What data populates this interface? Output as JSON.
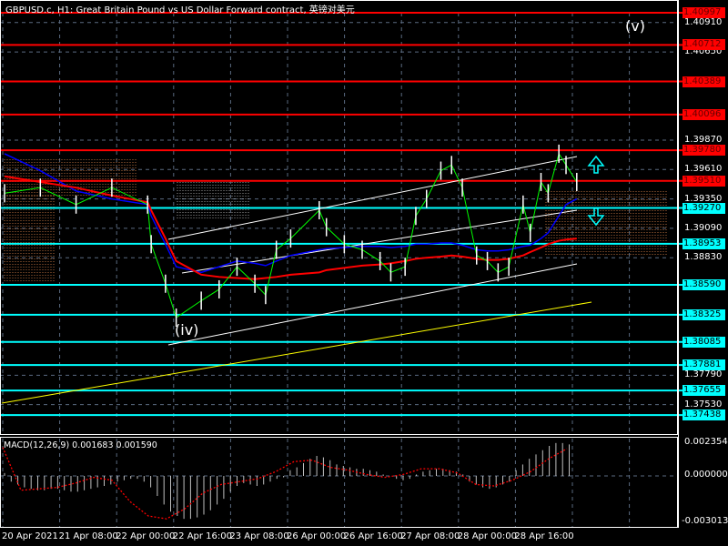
{
  "header": {
    "title": "GBPUSD.c, H1:  Great Britain Pound vs US Dollar Forward contract, 英镑对美元"
  },
  "annotations": {
    "wave_v": "(v)",
    "wave_iv": "(iv)"
  },
  "colors": {
    "background": "#000000",
    "resistance": "#ff0000",
    "support": "#00ffff",
    "price": "#00ff00",
    "ma_red": "#ff0000",
    "ma_blue": "#0000ff",
    "channel": "#ffffff",
    "trend": "#ffff00",
    "macd_signal": "#ff0000",
    "macd_hist": "#c0c0c0"
  },
  "price_levels": [
    {
      "label": "1.40997",
      "price": 1.40997,
      "type": "resistance"
    },
    {
      "label": "1.40712",
      "price": 1.40712,
      "type": "resistance"
    },
    {
      "label": "1.40389",
      "price": 1.40389,
      "type": "resistance"
    },
    {
      "label": "1.40096",
      "price": 1.40096,
      "type": "resistance"
    },
    {
      "label": "1.39780",
      "price": 1.3978,
      "type": "resistance"
    },
    {
      "label": "1.39510",
      "price": 1.3951,
      "type": "resistance"
    },
    {
      "label": "1.39270",
      "price": 1.3927,
      "type": "support"
    },
    {
      "label": "1.38953",
      "price": 1.38953,
      "type": "support"
    },
    {
      "label": "1.38590",
      "price": 1.3859,
      "type": "support"
    },
    {
      "label": "1.38325",
      "price": 1.38325,
      "type": "support"
    },
    {
      "label": "1.38085",
      "price": 1.38085,
      "type": "support"
    },
    {
      "label": "1.37881",
      "price": 1.37881,
      "type": "support"
    },
    {
      "label": "1.37655",
      "price": 1.37655,
      "type": "support"
    },
    {
      "label": "1.37438",
      "price": 1.37438,
      "type": "support"
    }
  ],
  "price_ticks": [
    "1.40910",
    "1.40650",
    "1.39870",
    "1.39610",
    "1.39350",
    "1.39090",
    "1.38830",
    "1.37790",
    "1.37530"
  ],
  "time_labels": [
    "20 Apr 2021",
    "21 Apr 08:00",
    "22 Apr 00:00",
    "22 Apr 16:00",
    "23 Apr 08:00",
    "26 Apr 00:00",
    "26 Apr 16:00",
    "27 Apr 08:00",
    "28 Apr 00:00",
    "28 Apr 16:00"
  ],
  "macd": {
    "label": "MACD(12,26,9) 0.001683 0.001590",
    "max_label": "0.002354",
    "zero_label": "0.000000",
    "min_label": "-0.003013"
  },
  "chart_data": {
    "type": "line",
    "title": "GBPUSD.c, H1",
    "ylim": [
      1.373,
      1.411
    ],
    "x_bars": [
      0,
      10,
      20,
      30,
      40,
      41,
      45,
      48,
      55,
      60,
      65,
      70,
      73,
      76,
      80,
      88,
      90,
      95,
      100,
      105,
      108,
      112,
      115,
      118,
      122,
      125,
      128,
      132,
      135,
      138,
      141,
      145,
      147,
      150,
      152,
      155,
      157,
      160
    ],
    "close": [
      1.394,
      1.3945,
      1.393,
      1.3945,
      1.393,
      1.3895,
      1.386,
      1.383,
      1.3845,
      1.3855,
      1.3875,
      1.386,
      1.385,
      1.389,
      1.39,
      1.3925,
      1.391,
      1.3895,
      1.389,
      1.388,
      1.387,
      1.3875,
      1.392,
      1.3935,
      1.396,
      1.3965,
      1.3945,
      1.3885,
      1.388,
      1.387,
      1.3875,
      1.393,
      1.3905,
      1.395,
      1.394,
      1.3975,
      1.3965,
      1.395
    ],
    "ma_red": [
      1.3955,
      1.395,
      1.3945,
      1.3938,
      1.3932,
      1.3925,
      1.39,
      1.388,
      1.3868,
      1.3866,
      1.3865,
      1.3864,
      1.3865,
      1.3866,
      1.3868,
      1.387,
      1.3872,
      1.3874,
      1.3876,
      1.3877,
      1.3878,
      1.388,
      1.3882,
      1.3883,
      1.3884,
      1.3885,
      1.3884,
      1.3882,
      1.3881,
      1.3881,
      1.3882,
      1.3885,
      1.3888,
      1.3892,
      1.3895,
      1.3898,
      1.3899,
      1.39
    ],
    "ma_blue": [
      1.3975,
      1.396,
      1.3942,
      1.3935,
      1.393,
      1.392,
      1.3895,
      1.3875,
      1.387,
      1.3875,
      1.388,
      1.3878,
      1.3876,
      1.388,
      1.3885,
      1.389,
      1.3891,
      1.3892,
      1.3893,
      1.3893,
      1.3892,
      1.3893,
      1.3895,
      1.3895,
      1.3896,
      1.3896,
      1.3894,
      1.389,
      1.3889,
      1.3889,
      1.389,
      1.3893,
      1.3894,
      1.39,
      1.3905,
      1.392,
      1.393,
      1.3935
    ],
    "macd_hist": [
      0.0002,
      -0.0004,
      -0.0006,
      -0.0008,
      -0.0009,
      -0.001,
      -0.001,
      -0.0009,
      -0.0009,
      -0.001,
      -0.0011,
      -0.0011,
      -0.001,
      -0.0009,
      -0.0008,
      -0.0007,
      -0.0006,
      -0.0004,
      -0.0003,
      -0.0002,
      -0.0002,
      -0.0004,
      -0.0008,
      -0.0014,
      -0.002,
      -0.0025,
      -0.0028,
      -0.003,
      -0.003,
      -0.0029,
      -0.0027,
      -0.0024,
      -0.002,
      -0.0016,
      -0.0011,
      -0.0007,
      -0.0005,
      -0.0006,
      -0.0007,
      -0.0006,
      -0.0004,
      -0.0002,
      -0.0001,
      0.0004,
      0.0006,
      0.0009,
      0.0012,
      0.0014,
      0.0013,
      0.0011,
      0.0008,
      0.0007,
      0.0006,
      0.0005,
      0.0005,
      0.0004,
      0.0003,
      0.0001,
      0.0,
      -0.0002,
      -0.0003,
      -0.0002,
      0.0001,
      0.0003,
      0.0004,
      0.0005,
      0.0005,
      0.0004,
      0.0003,
      0.0001,
      -0.0004,
      -0.0006,
      -0.0008,
      -0.0009,
      -0.0008,
      -0.0006,
      -0.0004,
      0.0004,
      0.0008,
      0.0012,
      0.0015,
      0.0018,
      0.0021,
      0.0023,
      0.0023,
      0.0022
    ],
    "macd_signal": [
      0.002,
      -0.001,
      -0.0009,
      -0.0008,
      -0.0005,
      -0.0001,
      -0.0003,
      -0.0018,
      -0.0028,
      -0.003,
      -0.0023,
      -0.0012,
      -0.0006,
      -0.0004,
      -0.0002,
      0.0003,
      0.001,
      0.0011,
      0.0006,
      0.0004,
      0.0001,
      -0.0001,
      0.0001,
      0.0005,
      0.0005,
      0.0002,
      -0.0006,
      -0.0007,
      -0.0003,
      0.0003,
      0.0012,
      0.0019
    ]
  }
}
